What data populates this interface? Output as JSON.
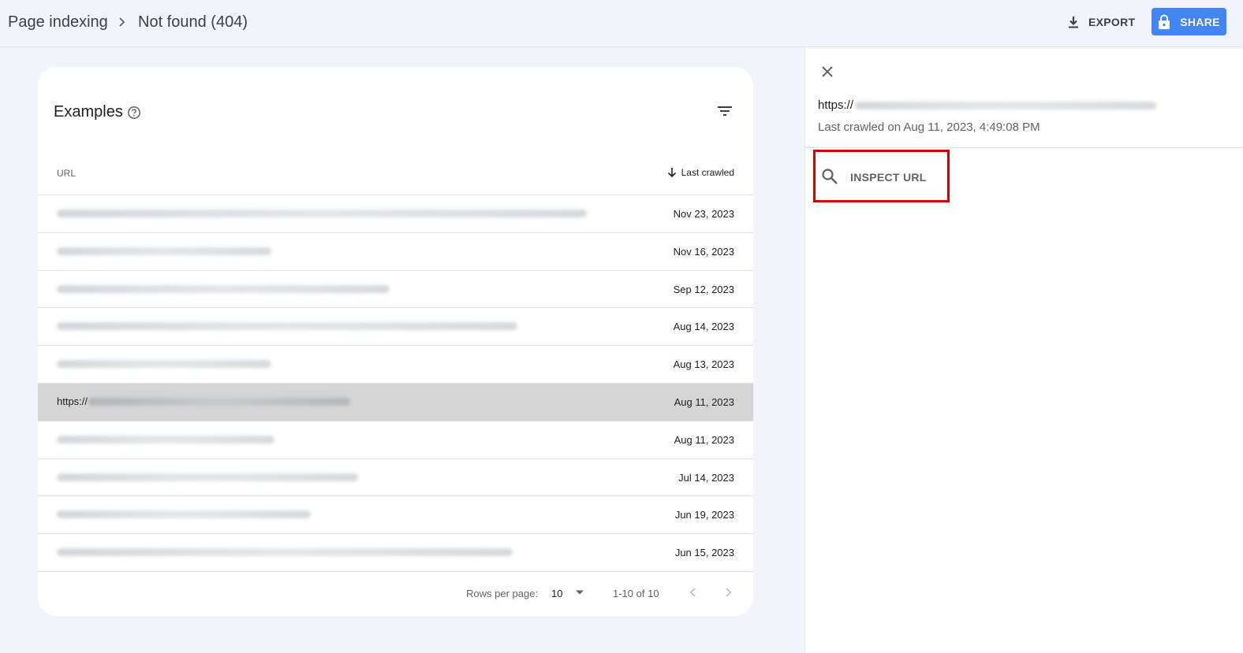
{
  "header": {
    "breadcrumb_root": "Page indexing",
    "breadcrumb_current": "Not found (404)",
    "export_label": "EXPORT",
    "share_label": "SHARE",
    "accent_color": "#4285f4"
  },
  "examples": {
    "title": "Examples",
    "columns": {
      "url": "URL",
      "last_crawled": "Last crawled"
    },
    "rows": [
      {
        "url_prefix": "",
        "date": "Nov 23, 2023",
        "selected": false
      },
      {
        "url_prefix": "",
        "date": "Nov 16, 2023",
        "selected": false
      },
      {
        "url_prefix": "",
        "date": "Sep 12, 2023",
        "selected": false
      },
      {
        "url_prefix": "",
        "date": "Aug 14, 2023",
        "selected": false
      },
      {
        "url_prefix": "",
        "date": "Aug 13, 2023",
        "selected": false
      },
      {
        "url_prefix": "https://",
        "date": "Aug 11, 2023",
        "selected": true
      },
      {
        "url_prefix": "",
        "date": "Aug 11, 2023",
        "selected": false
      },
      {
        "url_prefix": "",
        "date": "Jul 14, 2023",
        "selected": false
      },
      {
        "url_prefix": "",
        "date": "Jun 19, 2023",
        "selected": false
      },
      {
        "url_prefix": "",
        "date": "Jun 15, 2023",
        "selected": false
      }
    ],
    "pagination": {
      "rows_per_page_label": "Rows per page:",
      "rows_per_page_value": "10",
      "range": "1-10 of 10"
    }
  },
  "panel": {
    "url_prefix": "https://",
    "last_crawled": "Last crawled on Aug 11, 2023, 4:49:08 PM",
    "inspect_label": "INSPECT URL",
    "highlight_color": "#d40000"
  }
}
